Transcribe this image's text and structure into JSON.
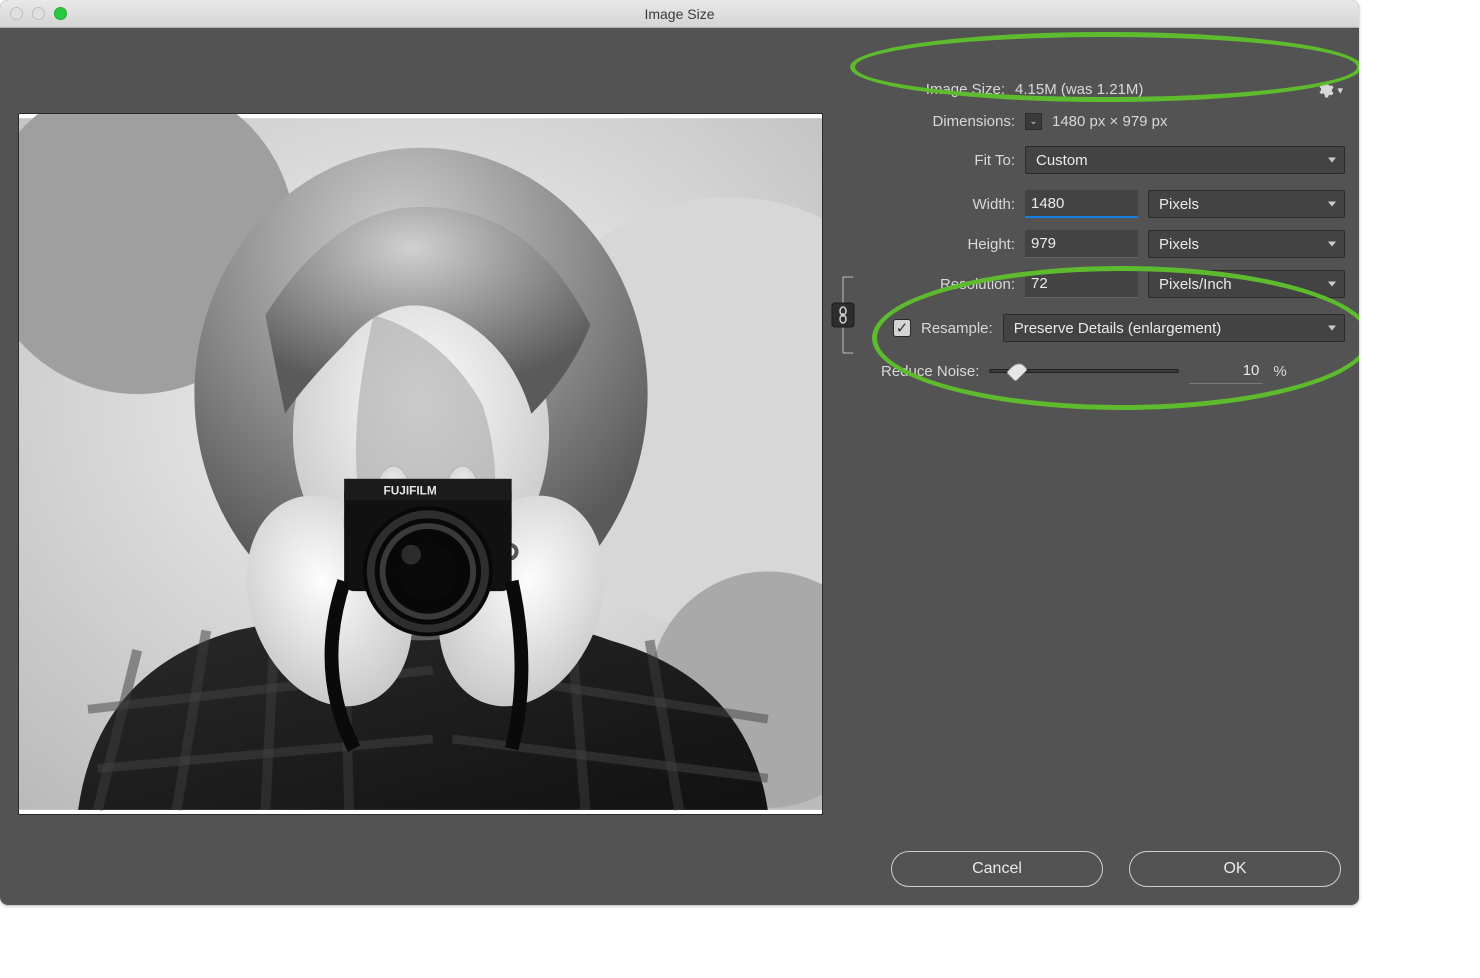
{
  "window": {
    "title": "Image Size"
  },
  "info": {
    "image_size_label": "Image Size:",
    "image_size_value": "4.15M (was 1.21M)",
    "dimensions_label": "Dimensions:",
    "dimensions_value": "1480 px  ×  979 px"
  },
  "fit": {
    "label": "Fit To:",
    "value": "Custom"
  },
  "width": {
    "label": "Width:",
    "value": "1480",
    "unit": "Pixels"
  },
  "height": {
    "label": "Height:",
    "value": "979",
    "unit": "Pixels"
  },
  "resolution": {
    "label": "Resolution:",
    "value": "72",
    "unit": "Pixels/Inch"
  },
  "resample": {
    "checked": true,
    "label": "Resample:",
    "method": "Preserve Details (enlargement)"
  },
  "noise": {
    "label": "Reduce Noise:",
    "value": "10",
    "suffix": "%"
  },
  "buttons": {
    "cancel": "Cancel",
    "ok": "OK"
  },
  "icons": {
    "gear": "gear",
    "chevron": "chevron",
    "check": "✓"
  },
  "colors": {
    "annotation": "#5dbb2d",
    "accent": "#1580e4"
  }
}
